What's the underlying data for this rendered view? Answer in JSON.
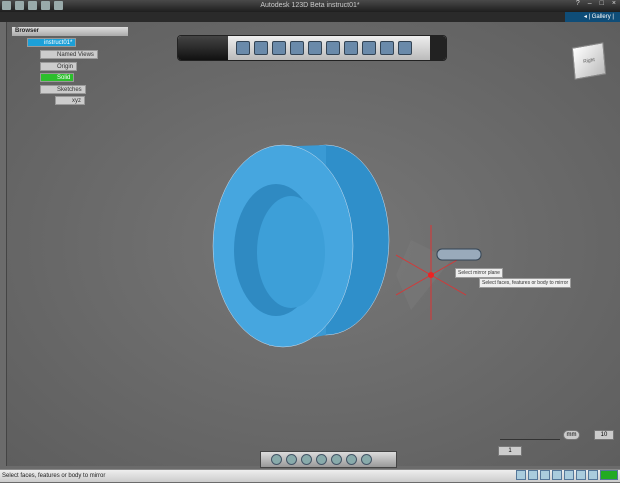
{
  "window": {
    "title": "Autodesk 123D Beta   instruct01*",
    "gallery": "◂ | Gallery |"
  },
  "browser": {
    "title": "Browser",
    "items": [
      {
        "label": "instruct01*"
      },
      {
        "label": "Named Views"
      },
      {
        "label": "Origin"
      },
      {
        "label": "Solid"
      },
      {
        "label": "Sketches"
      },
      {
        "label": "xyz"
      }
    ]
  },
  "tooltips": {
    "mirror_plane": "Select mirror plane",
    "mirror_bodies": "Select faces, features or body to mirror"
  },
  "viewcube": {
    "face": "Right"
  },
  "scale": {
    "left_value": "1",
    "unit": "mm",
    "right_value": "10"
  },
  "status": {
    "text": "Select faces, features or body to mirror"
  },
  "colors": {
    "part": "#3d9fd8",
    "accent": "#0f4d78"
  }
}
